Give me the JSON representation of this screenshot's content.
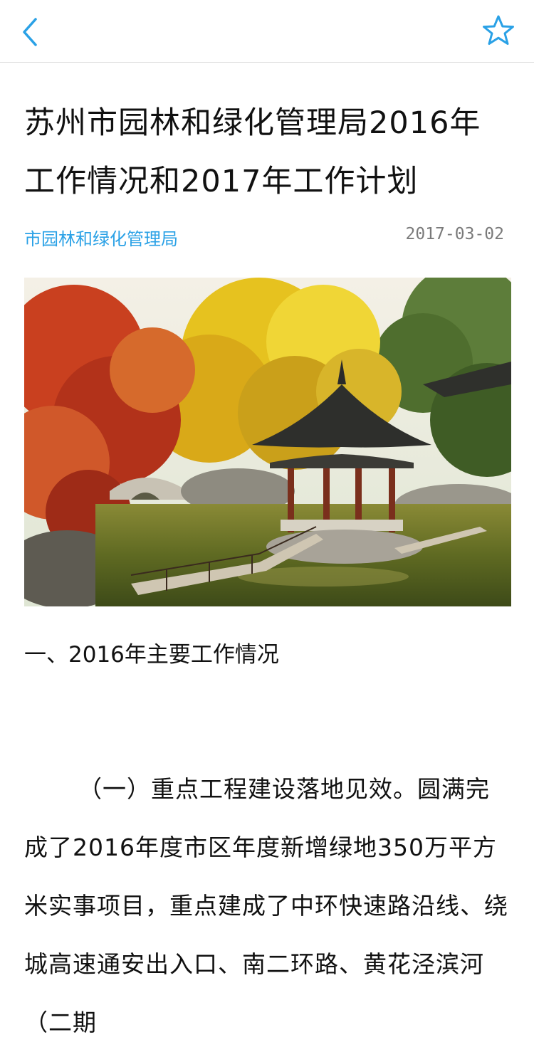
{
  "nav": {
    "back_icon": "chevron-left-icon",
    "favorite_icon": "star-outline-icon",
    "accent_color": "#2aa1e6"
  },
  "article": {
    "title": "苏州市园林和绿化管理局2016年工作情况和2017年工作计划",
    "source": "市园林和绿化管理局",
    "date": "2017-03-02",
    "section_heading": "一、2016年主要工作情况",
    "paragraph": "（一）重点工程建设落地见效。圆满完成了2016年度市区年度新增绿地350万平方米实事项目，重点建成了中环快速路沿线、绕城高速通安出入口、南二环路、黄花泾滨河（二期"
  }
}
